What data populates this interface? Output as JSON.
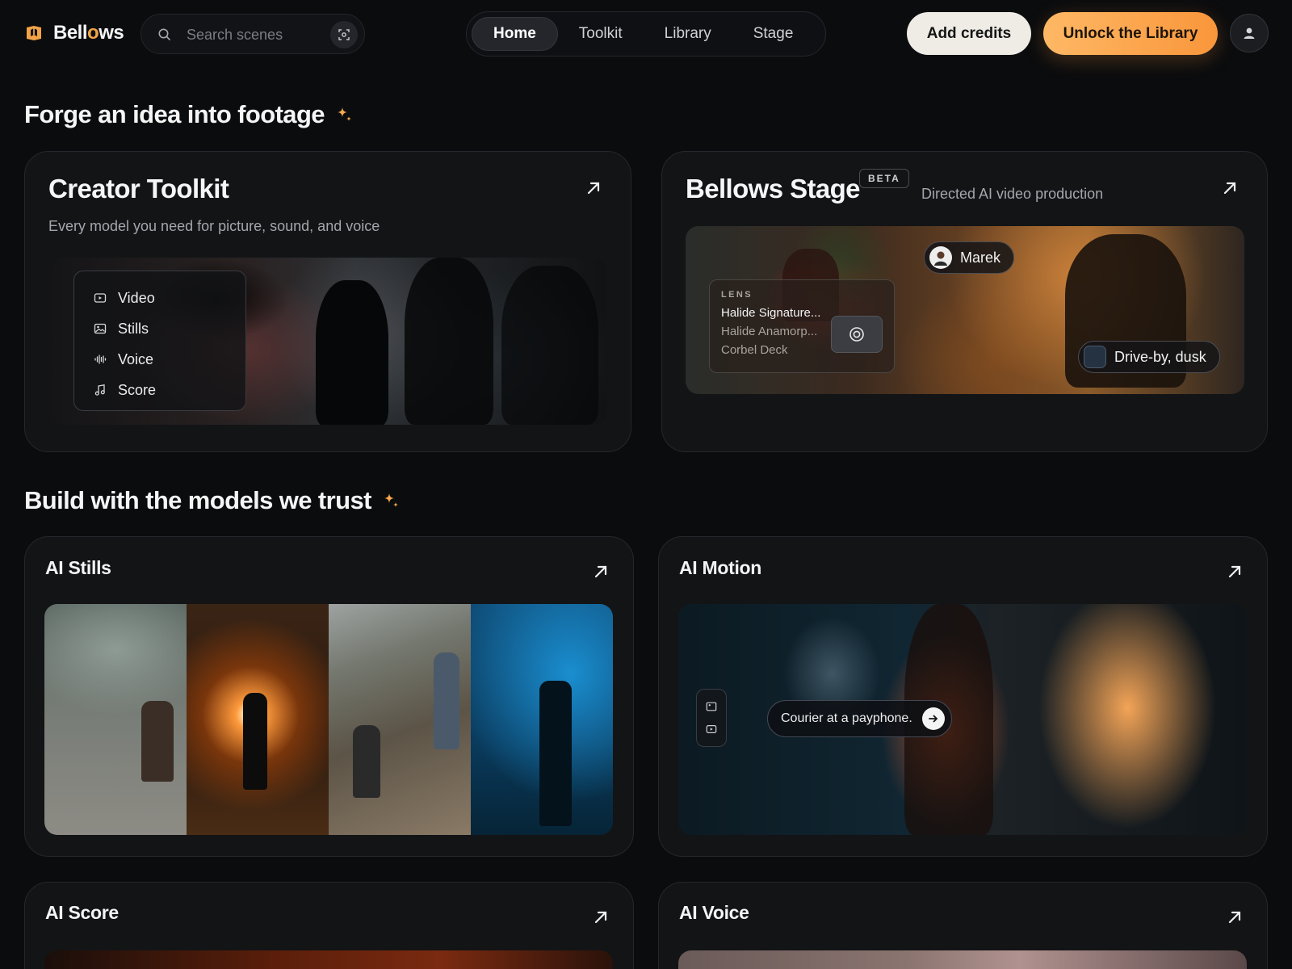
{
  "brand": {
    "name_prefix": "Bell",
    "name_accent": "o",
    "name_suffix": "ws"
  },
  "search": {
    "placeholder": "Search scenes"
  },
  "nav": {
    "home": "Home",
    "toolkit": "Toolkit",
    "library": "Library",
    "stage": "Stage"
  },
  "actions": {
    "add_credits": "Add credits",
    "unlock": "Unlock the Library"
  },
  "sections": {
    "forge_title": "Forge an idea into footage",
    "models_title": "Build with the models we trust"
  },
  "toolkit": {
    "title": "Creator Toolkit",
    "subtitle": "Every model you need for picture, sound, and voice",
    "menu": [
      "Video",
      "Stills",
      "Voice",
      "Score"
    ]
  },
  "stage": {
    "title": "Bellows Stage",
    "badge": "BETA",
    "subtitle": "Directed AI video production",
    "character_chip": "Marek",
    "lens_label": "LENS",
    "lens_options": [
      "Halide Signature...",
      "Halide Anamorp...",
      "Corbel Deck"
    ],
    "scene_chip": "Drive-by, dusk"
  },
  "models": {
    "stills_title": "AI Stills",
    "motion_title": "AI Motion",
    "motion_prompt": "Courier at a payphone.",
    "score_title": "AI Score",
    "voice_title": "AI Voice"
  },
  "colors": {
    "accent": "#f9963b",
    "background": "#0b0c0e",
    "card": "#131416"
  }
}
